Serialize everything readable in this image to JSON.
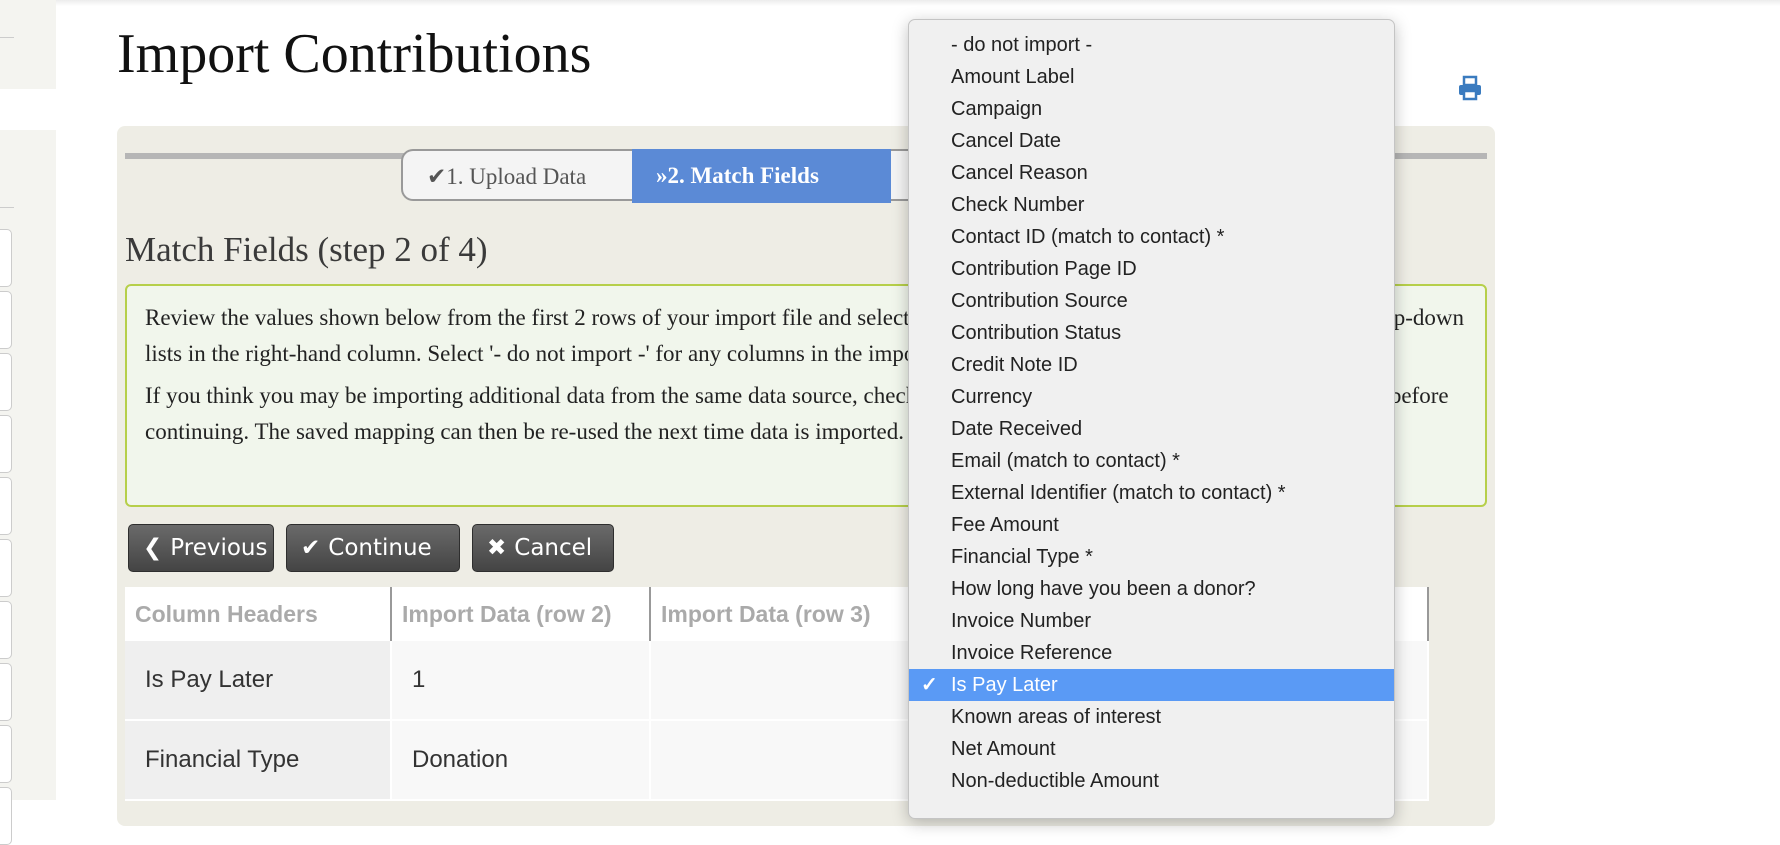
{
  "page": {
    "title": "Import Contributions",
    "print_icon": "print-icon"
  },
  "wizard": {
    "tabs": [
      {
        "label": "✔1. Upload Data",
        "state": "done"
      },
      {
        "label": "»2. Match Fields",
        "state": "active"
      },
      {
        "label": "",
        "state": "pending"
      }
    ],
    "active_color": "#5b8ad6"
  },
  "section": {
    "title": "Match Fields (step 2 of 4)",
    "help": [
      "Review the values shown below from the first 2 rows of your import file and select the matching CiviCRM database fields from the drop-down lists in the right-hand column. Select '- do not import -' for any columns in the import file that you want ignored.",
      "If you think you may be importing additional data from the same data source, check 'Save this field mapping' at the bottom of the page before continuing. The saved mapping can then be re-used the next time data is imported."
    ]
  },
  "buttons": {
    "previous": "Previous",
    "continue": "Continue",
    "cancel": "Cancel"
  },
  "table": {
    "headers": [
      "Column Headers",
      "Import Data (row 2)",
      "Import Data (row 3)",
      ""
    ],
    "rows": [
      [
        "Is Pay Later",
        "1",
        "",
        ""
      ],
      [
        "Financial Type",
        "Donation",
        "",
        ""
      ]
    ]
  },
  "dropdown": {
    "selected": "Is Pay Later",
    "options": [
      "- do not import -",
      "Amount Label",
      "Campaign",
      "Cancel Date",
      "Cancel Reason",
      "Check Number",
      "Contact ID (match to contact) *",
      "Contribution Page ID",
      "Contribution Source",
      "Contribution Status",
      "Credit Note ID",
      "Currency",
      "Date Received",
      "Email (match to contact) *",
      "External Identifier (match to contact) *",
      "Fee Amount",
      "Financial Type *",
      "How long have you been a donor?",
      "Invoice Number",
      "Invoice Reference",
      "Is Pay Later",
      "Known areas of interest",
      "Net Amount",
      "Non-deductible Amount"
    ],
    "highlight_color": "#5a9af5"
  }
}
